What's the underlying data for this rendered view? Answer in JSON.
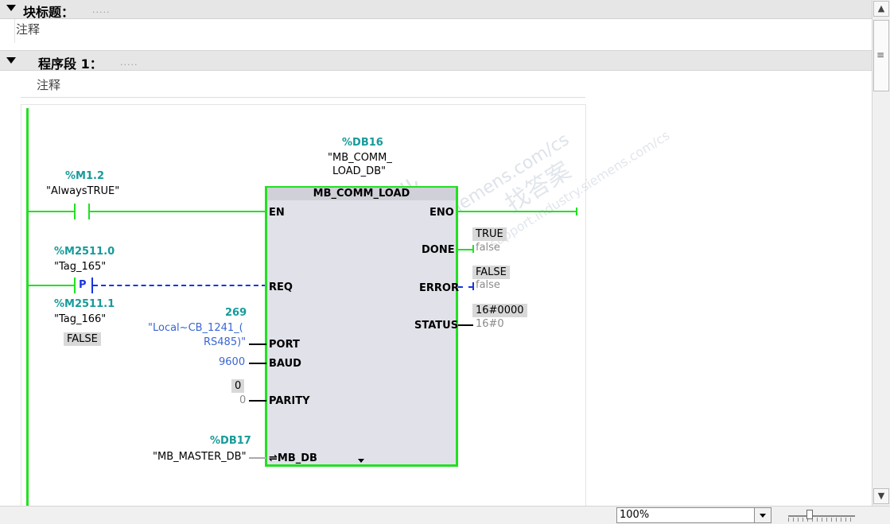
{
  "block": {
    "title": "块标题：",
    "title_dots": ".....",
    "comment": "注释"
  },
  "network": {
    "title": "程序段 1：",
    "title_dots": ".....",
    "comment": "注释"
  },
  "ladder": {
    "contact1": {
      "address": "%M1.2",
      "name": "\"AlwaysTRUE\""
    },
    "contact2": {
      "address": "%M2511.0",
      "name": "\"Tag_165\"",
      "type_label": "P"
    },
    "contact2_sub": {
      "address": "%M2511.1",
      "name": "\"Tag_166\"",
      "value": "FALSE"
    },
    "fb": {
      "instance_address": "%DB16",
      "instance_name_line1": "\"MB_COMM_",
      "instance_name_line2": "LOAD_DB\"",
      "type_name": "MB_COMM_LOAD",
      "inputs": {
        "en": "EN",
        "req": "REQ",
        "port": "PORT",
        "baud": "BAUD",
        "parity": "PARITY",
        "mb_db": "⇌MB_DB"
      },
      "outputs": {
        "eno": "ENO",
        "done": "DONE",
        "error": "ERROR",
        "status": "STATUS"
      }
    },
    "port_param": {
      "value": "269",
      "name_line1": "\"Local~CB_1241_(",
      "name_line2": "RS485)\""
    },
    "baud_param": {
      "value": "9600"
    },
    "parity_param": {
      "monitor": "0",
      "value": "0"
    },
    "mbdb_param": {
      "address": "%DB17",
      "name": "\"MB_MASTER_DB\""
    },
    "done_out": {
      "monitor": "TRUE",
      "value": "false"
    },
    "error_out": {
      "monitor": "FALSE",
      "value": "false"
    },
    "status_out": {
      "monitor": "16#0000",
      "value": "16#0"
    }
  },
  "watermark": {
    "text1": "西门子工业",
    "text2": "support.industry.siemens.com/cs",
    "text3": "找答案",
    "text4": "support.industry.siemens.com/cs"
  },
  "scrollbar": {
    "up_icon": "▲",
    "down_icon": "▼",
    "grip": "≡"
  },
  "zoom": {
    "value": "100%"
  },
  "colors": {
    "energized": "#22e022",
    "address": "#179a9a",
    "unpowered": "#1a35e0"
  }
}
